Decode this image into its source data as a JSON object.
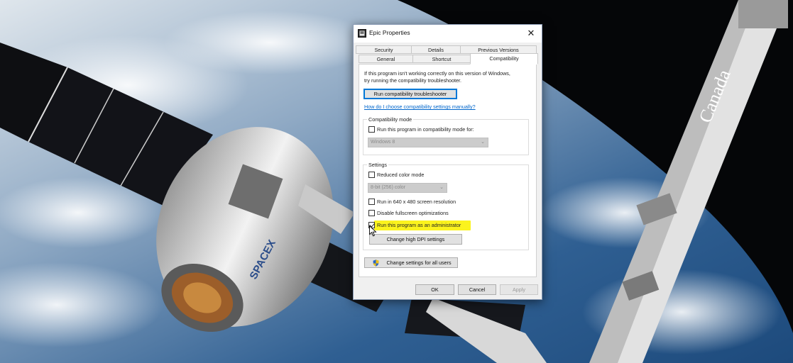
{
  "dialog": {
    "title": "Epic Properties",
    "close_glyph": "✕",
    "tabs_top": [
      "Security",
      "Details",
      "Previous Versions"
    ],
    "tabs_bottom": [
      "General",
      "Shortcut",
      "Compatibility"
    ],
    "intro_line1": "If this program isn't working correctly on this version of Windows,",
    "intro_line2": "try running the compatibility troubleshooter.",
    "troubleshooter_button": "Run compatibility troubleshooter",
    "manual_link": "How do I choose compatibility settings manually?",
    "compat_mode": {
      "label": "Compatibility mode",
      "checkbox_label": "Run this program in compatibility mode for:",
      "checked": false,
      "os_value": "Windows 8"
    },
    "settings": {
      "label": "Settings",
      "reduced_color": {
        "label": "Reduced color mode",
        "checked": false
      },
      "color_value": "8-bit (256) color",
      "resolution_640": {
        "label": "Run in 640 x 480 screen resolution",
        "checked": false
      },
      "disable_fullscreen": {
        "label": "Disable fullscreen optimizations",
        "checked": false
      },
      "run_as_admin": {
        "label": "Run this program as an administrator",
        "checked": true
      },
      "dpi_button": "Change high DPI settings"
    },
    "all_users_button": "Change settings for all users",
    "footer": {
      "ok": "OK",
      "cancel": "Cancel",
      "apply": "Apply"
    }
  },
  "wallpaper": {
    "text_canada": "Canada",
    "text_spacex": "SPACEX"
  },
  "colors": {
    "highlight": "#fbf31e",
    "link": "#0066cc",
    "focus": "#0078d7"
  }
}
